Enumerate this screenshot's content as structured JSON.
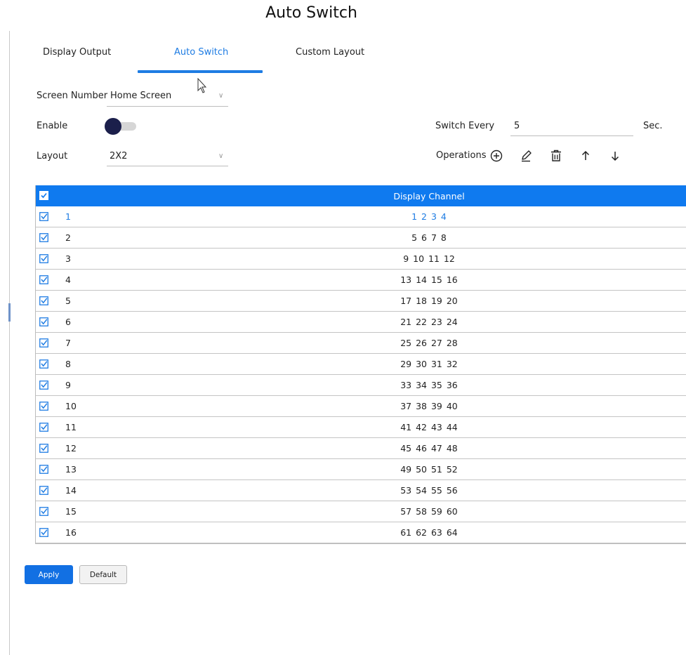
{
  "page": {
    "title": "Auto Switch"
  },
  "tabs": [
    {
      "label": "Display Output",
      "active": false
    },
    {
      "label": "Auto Switch",
      "active": true
    },
    {
      "label": "Custom Layout",
      "active": false
    }
  ],
  "form": {
    "screen_number": {
      "label": "Screen Number",
      "value": "Home Screen"
    },
    "enable": {
      "label": "Enable",
      "value": false
    },
    "layout": {
      "label": "Layout",
      "value": "2X2"
    },
    "switch_every": {
      "label": "Switch Every",
      "value": "5",
      "unit": "Sec."
    },
    "operations": {
      "label": "Operations",
      "icons": [
        "add-circle-icon",
        "edit-pencil-icon",
        "delete-trash-icon",
        "arrow-up-icon",
        "arrow-down-icon"
      ]
    }
  },
  "table": {
    "header": {
      "column": "Display Channel",
      "all_checked": true
    },
    "rows": [
      {
        "index": "1",
        "channels": "1 2 3 4"
      },
      {
        "index": "2",
        "channels": "5 6 7 8"
      },
      {
        "index": "3",
        "channels": "9 10 11 12"
      },
      {
        "index": "4",
        "channels": "13 14 15 16"
      },
      {
        "index": "5",
        "channels": "17 18 19 20"
      },
      {
        "index": "6",
        "channels": "21 22 23 24"
      },
      {
        "index": "7",
        "channels": "25 26 27 28"
      },
      {
        "index": "8",
        "channels": "29 30 31 32"
      },
      {
        "index": "9",
        "channels": "33 34 35 36"
      },
      {
        "index": "10",
        "channels": "37 38 39 40"
      },
      {
        "index": "11",
        "channels": "41 42 43 44"
      },
      {
        "index": "12",
        "channels": "45 46 47 48"
      },
      {
        "index": "13",
        "channels": "49 50 51 52"
      },
      {
        "index": "14",
        "channels": "53 54 55 56"
      },
      {
        "index": "15",
        "channels": "57 58 59 60"
      },
      {
        "index": "16",
        "channels": "61 62 63 64"
      }
    ]
  },
  "buttons": {
    "apply": "Apply",
    "default": "Default"
  },
  "colors": {
    "accent": "#1e7ce3",
    "header_bg": "#0f7aef",
    "toggle_knob": "#1b1f4b"
  }
}
